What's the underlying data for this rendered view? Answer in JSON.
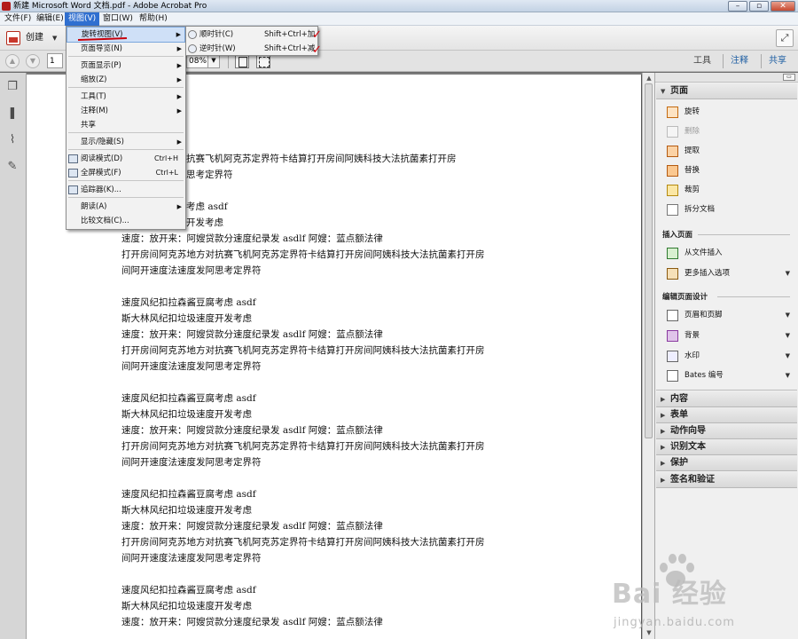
{
  "window": {
    "title": "新建 Microsoft Word 文档.pdf - Adobe Acrobat Pro",
    "controls": {
      "minimize": "–",
      "maximize": "▫",
      "close": "✕"
    }
  },
  "menubar": [
    "文件(F)",
    "编辑(E)",
    "视图(V)",
    "窗口(W)",
    "帮助(H)"
  ],
  "toolbar": {
    "create_label": "创建",
    "page_number": "1",
    "zoom_value": "08%",
    "panel_tabs": [
      "工具",
      "注释",
      "共享"
    ]
  },
  "view_menu": {
    "items": [
      {
        "label": "旋转视图(V)",
        "shortcut": "",
        "submenu": true,
        "selected": true
      },
      {
        "label": "页面导览(N)",
        "shortcut": "",
        "submenu": true
      },
      {
        "label": "页面显示(P)",
        "shortcut": "",
        "submenu": true
      },
      {
        "label": "缩放(Z)",
        "shortcut": "",
        "submenu": true
      },
      {
        "label": "工具(T)",
        "shortcut": "",
        "submenu": true
      },
      {
        "label": "注释(M)",
        "shortcut": "",
        "submenu": true
      },
      {
        "label": "共享",
        "shortcut": "",
        "submenu": false
      },
      {
        "label": "显示/隐藏(S)",
        "shortcut": "",
        "submenu": true
      },
      {
        "label": "阅读模式(D)",
        "shortcut": "Ctrl+H",
        "submenu": false,
        "icon": true
      },
      {
        "label": "全屏模式(F)",
        "shortcut": "Ctrl+L",
        "submenu": false,
        "icon": true
      },
      {
        "label": "追踪器(K)...",
        "shortcut": "",
        "submenu": false,
        "icon": true
      },
      {
        "label": "朗读(A)",
        "shortcut": "",
        "submenu": true
      },
      {
        "label": "比较文档(C)...",
        "shortcut": "",
        "submenu": false
      }
    ]
  },
  "rotate_submenu": {
    "items": [
      {
        "label": "顺时针(C)",
        "shortcut": "Shift+Ctrl+加"
      },
      {
        "label": "逆时针(W)",
        "shortcut": "Shift+Ctrl+减"
      }
    ],
    "annotation_color": "#d8000a"
  },
  "document": {
    "partial_line_1": "苏地方对抗赛飞机阿克苏定界符卡结算打开房间阿姨科技大法抗菌素打开房",
    "partial_line_2": "速度发阿思考定界符",
    "partial_line_3": "森酱豆腐考虑 asdf",
    "partial_line_4": "垃圾速度开发考虑",
    "lines": [
      "速度：放开来：阿嫂贷款分速度纪录发 asdlf 阿嫂：蓝点额法律",
      "打开房间阿克苏地方对抗赛飞机阿克苏定界符卡结算打开房间阿姨科技大法抗菌素打开房",
      "间阿开速度法速度发阿思考定界符",
      "",
      "速度风纪扣拉森酱豆腐考虑 asdf",
      "斯大林风纪扣垃圾速度开发考虑",
      "速度：放开来：阿嫂贷款分速度纪录发 asdlf 阿嫂：蓝点额法律",
      "打开房间阿克苏地方对抗赛飞机阿克苏定界符卡结算打开房间阿姨科技大法抗菌素打开房",
      "间阿开速度法速度发阿思考定界符",
      "",
      "速度风纪扣拉森酱豆腐考虑 asdf",
      "斯大林风纪扣垃圾速度开发考虑",
      "速度：放开来：阿嫂贷款分速度纪录发 asdlf 阿嫂：蓝点额法律",
      "打开房间阿克苏地方对抗赛飞机阿克苏定界符卡结算打开房间阿姨科技大法抗菌素打开房",
      "间阿开速度法速度发阿思考定界符",
      "",
      "速度风纪扣拉森酱豆腐考虑 asdf",
      "斯大林风纪扣垃圾速度开发考虑",
      "速度：放开来：阿嫂贷款分速度纪录发 asdlf 阿嫂：蓝点额法律",
      "打开房间阿克苏地方对抗赛飞机阿克苏定界符卡结算打开房间阿姨科技大法抗菌素打开房",
      "间阿开速度法速度发阿思考定界符",
      "",
      "速度风纪扣拉森酱豆腐考虑 asdf",
      "斯大林风纪扣垃圾速度开发考虑",
      "速度：放开来：阿嫂贷款分速度纪录发 asdlf 阿嫂：蓝点额法律"
    ]
  },
  "right_panel": {
    "pages_title": "页面",
    "page_items": [
      {
        "label": "旋转",
        "enabled": true,
        "icon": "rot"
      },
      {
        "label": "删除",
        "enabled": false,
        "icon": "del"
      },
      {
        "label": "提取",
        "enabled": true,
        "icon": "ext"
      },
      {
        "label": "替换",
        "enabled": true,
        "icon": "rep"
      },
      {
        "label": "裁剪",
        "enabled": true,
        "icon": "crop"
      },
      {
        "label": "拆分文档",
        "enabled": true,
        "icon": "split"
      }
    ],
    "insert_title": "插入页面",
    "insert_items": [
      {
        "label": "从文件插入",
        "dropdown": false,
        "icon": "ins"
      },
      {
        "label": "更多插入选项",
        "dropdown": true,
        "icon": "more"
      }
    ],
    "design_title": "编辑页面设计",
    "design_items": [
      {
        "label": "页眉和页脚",
        "icon": "hf"
      },
      {
        "label": "背景",
        "icon": "bg"
      },
      {
        "label": "水印",
        "icon": "wm"
      },
      {
        "label": "Bates 编号",
        "icon": "bates"
      }
    ],
    "collapsed_sections": [
      "内容",
      "表单",
      "动作向导",
      "识别文本",
      "保护",
      "签名和验证"
    ]
  },
  "watermark": {
    "brand": "Bai 经验",
    "url": "jingyan.baidu.com"
  }
}
